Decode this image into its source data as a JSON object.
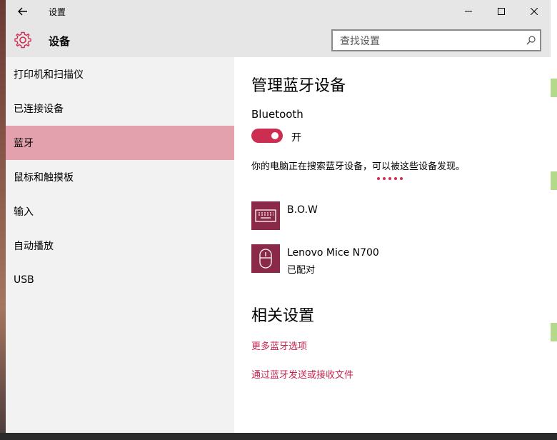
{
  "window": {
    "title": "设置",
    "back_icon": "arrow-left-icon",
    "controls": [
      "minimize-icon",
      "maximize-icon",
      "close-icon"
    ]
  },
  "header": {
    "title": "设备",
    "icon": "gear-icon",
    "search_placeholder": "查找设置",
    "accent": "#cc2e52"
  },
  "sidebar": {
    "items": [
      {
        "label": "打印机和扫描仪",
        "active": false
      },
      {
        "label": "已连接设备",
        "active": false
      },
      {
        "label": "蓝牙",
        "active": true
      },
      {
        "label": "鼠标和触摸板",
        "active": false
      },
      {
        "label": "输入",
        "active": false
      },
      {
        "label": "自动播放",
        "active": false
      },
      {
        "label": "USB",
        "active": false
      }
    ]
  },
  "main": {
    "title": "管理蓝牙设备",
    "bluetooth_label": "Bluetooth",
    "toggle_state": "开",
    "toggle_on": true,
    "searching_text": "你的电脑正在搜索蓝牙设备，可以被这些设备发现。",
    "devices": [
      {
        "name": "B.O.W",
        "status": "",
        "icon": "keyboard-icon"
      },
      {
        "name": "Lenovo Mice N700",
        "status": "已配对",
        "icon": "mouse-icon"
      }
    ],
    "related_title": "相关设置",
    "links": [
      "更多蓝牙选项",
      "通过蓝牙发送或接收文件"
    ]
  }
}
